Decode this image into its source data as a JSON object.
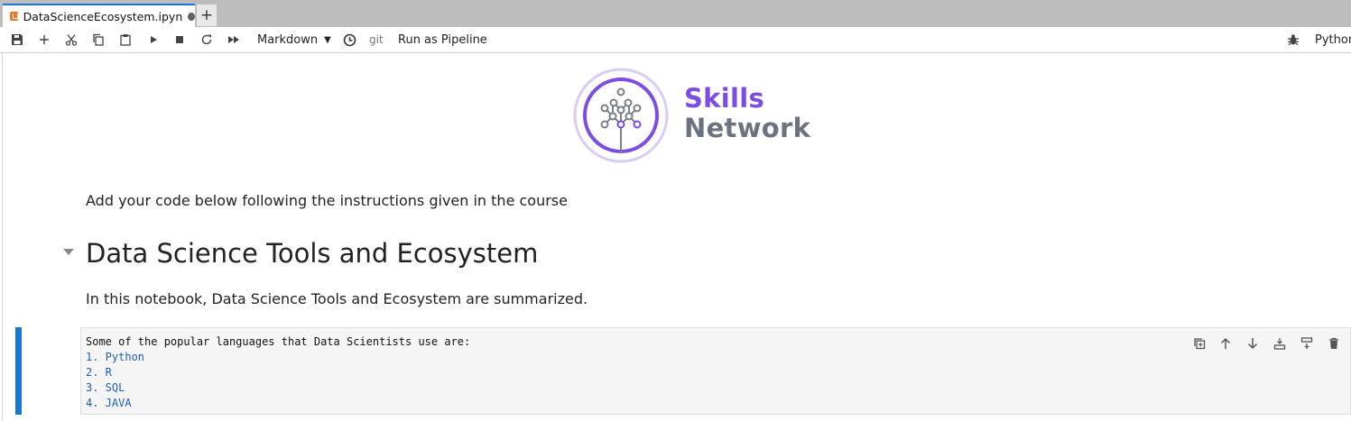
{
  "tab": {
    "title": "DataScienceEcosystem.ipyn",
    "new_tab_label": "+"
  },
  "toolbar": {
    "cell_type": "Markdown",
    "git_label": "git",
    "pipeline_label": "Run as Pipeline",
    "kernel_name": "Python"
  },
  "logo": {
    "line1": "Skills",
    "line2": "Network"
  },
  "notebook": {
    "intro": "Add your code below following the instructions given in the course",
    "heading": "Data Science Tools and Ecosystem",
    "summary": "In this notebook, Data Science Tools and Ecosystem are summarized.",
    "active_cell": {
      "first_line": "Some of the popular languages that Data Scientists use are:",
      "items": [
        "1. Python",
        "2. R",
        "3. SQL",
        "4. JAVA"
      ]
    }
  },
  "colors": {
    "accent": "#1976d2",
    "logo_purple": "#7b4ce6",
    "logo_gray": "#6c7380"
  }
}
